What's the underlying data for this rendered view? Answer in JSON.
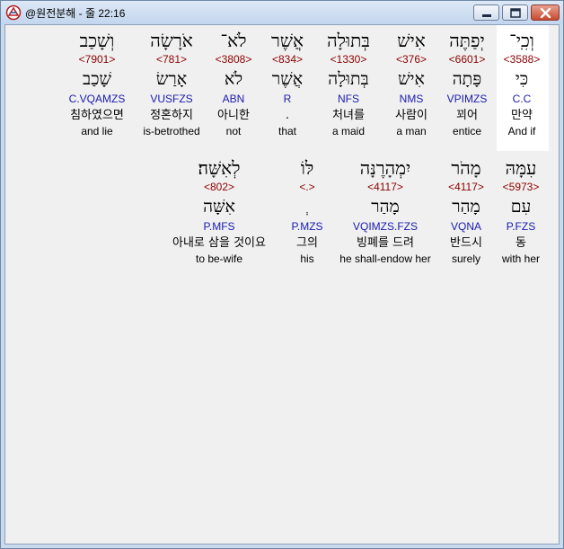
{
  "window": {
    "title": "@원전분해 - 줄 22:16"
  },
  "rows": [
    {
      "words": [
        {
          "heb": "וְכִֽי־",
          "strong": "<3588>",
          "lex": "כִּי",
          "parse": "C.C",
          "kor": "만약",
          "eng": "And if"
        },
        {
          "heb": "יְפַתֶּה",
          "strong": "<6601>",
          "lex": "פָּתָה",
          "parse": "VPIMZS",
          "kor": "꾀어",
          "eng": "entice"
        },
        {
          "heb": "אִישׁ",
          "strong": "<376>",
          "lex": "אִישׁ",
          "parse": "NMS",
          "kor": "사람이",
          "eng": "a man"
        },
        {
          "heb": "בְּתוּלָה",
          "strong": "<1330>",
          "lex": "בְּתוּלָה",
          "parse": "NFS",
          "kor": "처녀를",
          "eng": "a maid"
        },
        {
          "heb": "אֲשֶׁר",
          "strong": "<834>",
          "lex": "אֲשֶׁר",
          "parse": "R",
          "kor": ".",
          "eng": "that"
        },
        {
          "heb": "לֹא־",
          "strong": "<3808>",
          "lex": "לֹא",
          "parse": "ABN",
          "kor": "아니한",
          "eng": "not"
        },
        {
          "heb": "אֹרָשָׂה",
          "strong": "<781>",
          "lex": "אָרַשׂ",
          "parse": "VUSFZS",
          "kor": "정혼하지",
          "eng": "is-betrothed"
        },
        {
          "heb": "וְשָׁכַב",
          "strong": "<7901>",
          "lex": "שָׁכַב",
          "parse": "C.VQAMZS",
          "kor": "침하였으면",
          "eng": "and lie"
        }
      ]
    },
    {
      "words": [
        {
          "heb": "עִמָּהּ",
          "strong": "<5973>",
          "lex": "עִם",
          "parse": "P.FZS",
          "kor": "동",
          "eng": "with her"
        },
        {
          "heb": "מָהֹר",
          "strong": "<4117>",
          "lex": "מָהַר",
          "parse": "VQNA",
          "kor": "반드시",
          "eng": "surely"
        },
        {
          "heb": "יִמְהָרֶנָּה",
          "strong": "<4117>",
          "lex": "מָהַר",
          "parse": "VQIMZS.FZS",
          "kor": "빙폐를 드려",
          "eng": "he shall-endow her"
        },
        {
          "heb": "לּוֹ",
          "strong": "<.>",
          "lex": "ְ",
          "parse": "P.MZS",
          "kor": "그의",
          "eng": "his"
        },
        {
          "heb": "לְאִשָּׁה׃",
          "strong": "<802>",
          "lex": "אִשָּׁה",
          "parse": "P.MFS",
          "kor": "아내로 삼을 것이요",
          "eng": "to be-wife"
        }
      ]
    }
  ]
}
